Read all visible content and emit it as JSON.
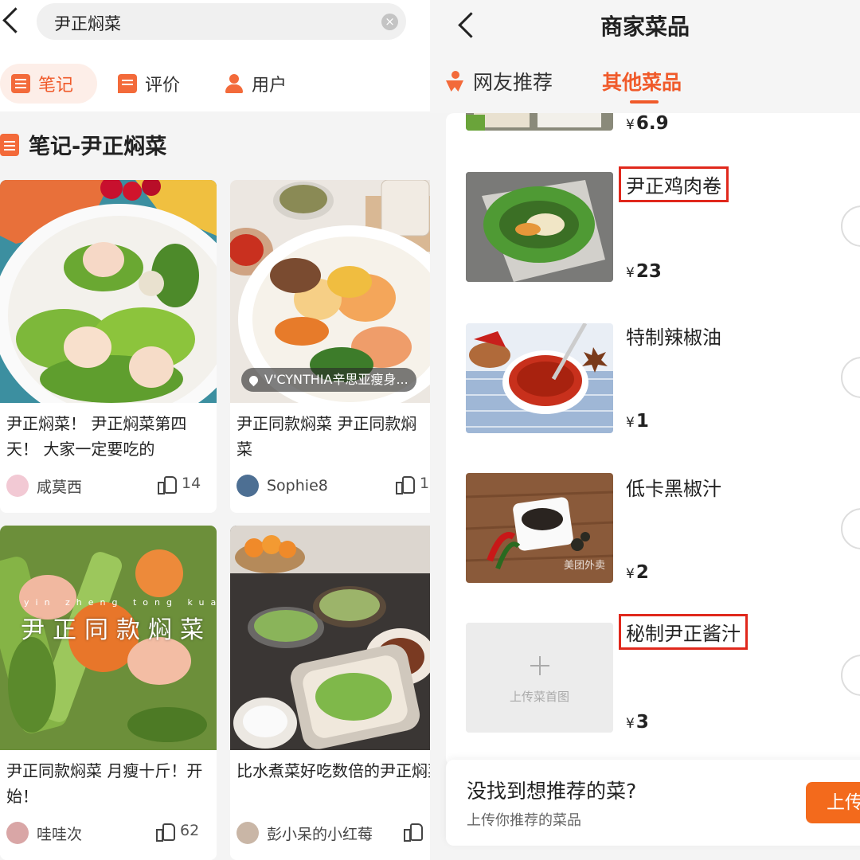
{
  "left": {
    "search_text": "尹正焖菜",
    "clear_glyph": "×",
    "tabs": [
      {
        "label": "笔记",
        "icon": "notes-icon",
        "active": true
      },
      {
        "label": "评价",
        "icon": "review-icon",
        "active": false
      },
      {
        "label": "用户",
        "icon": "user-icon",
        "active": false
      }
    ],
    "section_title": "笔记-尹正焖菜",
    "cards": [
      {
        "title": "尹正焖菜！ 尹正焖菜第四天！ 大家一定要吃的",
        "author": "咸莫西",
        "likes": "14"
      },
      {
        "title": "尹正同款焖菜 尹正同款焖菜",
        "author": "Sophie8",
        "likes": "1",
        "location": "V'CYNTHIA辛思亚瘦身..."
      },
      {
        "title": "尹正同款焖菜 月瘦十斤！开始！",
        "author": "哇哇次",
        "likes": "62",
        "overlay_text": "尹正同款焖菜",
        "overlay_pinyin": "yin zheng tong kuan men cai"
      },
      {
        "title": "比水煮菜好吃数倍的尹正焖菜我也来尝试一下减肉",
        "author": "彭小呆的小红莓",
        "likes": ""
      }
    ]
  },
  "right": {
    "title": "商家菜品",
    "tabs": [
      {
        "label": "网友推荐",
        "icon": "person-icon",
        "active": false
      },
      {
        "label": "其他菜品",
        "active": true
      }
    ],
    "currency": "¥",
    "dishes": [
      {
        "name": "",
        "price": "6.9"
      },
      {
        "name": "尹正鸡肉卷",
        "price": "23",
        "highlighted": true
      },
      {
        "name": "特制辣椒油",
        "price": "1",
        "highlighted": false
      },
      {
        "name": "低卡黑椒汁",
        "price": "2",
        "highlighted": false,
        "watermark": "美团外卖"
      },
      {
        "name": "秘制尹正酱汁",
        "price": "3",
        "highlighted": true
      }
    ],
    "upload_placeholder": "上传菜首图",
    "bottom": {
      "title": "没找到想推荐的菜?",
      "subtitle": "上传你推荐的菜品",
      "button": "上传"
    }
  },
  "colors": {
    "accent": "#f05a2a",
    "highlight_box": "#e0281c",
    "button": "#f36a1c"
  }
}
